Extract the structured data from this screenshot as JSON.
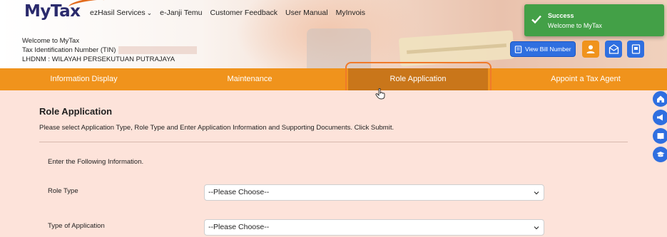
{
  "header": {
    "logo_text": "MyTax",
    "nav": [
      {
        "label": "ezHasil Services",
        "has_dropdown": true
      },
      {
        "label": "e-Janji Temu"
      },
      {
        "label": "Customer Feedback"
      },
      {
        "label": "User Manual"
      },
      {
        "label": "MyInvois"
      }
    ],
    "welcome": {
      "line1": "Welcome to MyTax",
      "line2": "Tax Identification Number (TIN)",
      "line3": "LHDNM : WILAYAH PERSEKUTUAN PUTRAJAYA"
    },
    "view_bill_label": "View Bill Number"
  },
  "toast": {
    "title": "Success",
    "message": "Welcome to MyTax",
    "color": "#43a047"
  },
  "tabs": [
    {
      "label": "Information Display"
    },
    {
      "label": "Maintenance"
    },
    {
      "label": "Role Application",
      "active": true
    },
    {
      "label": "Appoint a Tax Agent"
    }
  ],
  "form": {
    "title": "Role Application",
    "instructions": "Please select Application Type, Role Type and Enter Application Information and Supporting Documents. Click Submit.",
    "section_label": "Enter the Following Information.",
    "fields": [
      {
        "label": "Role Type",
        "value": "--Please Choose--"
      },
      {
        "label": "Type of Application",
        "value": "--Please Choose--"
      }
    ]
  },
  "colors": {
    "accent_orange": "#f0931c",
    "active_tab": "#c9761a",
    "primary_blue": "#2f6fe0",
    "page_bg": "#fde3da"
  },
  "side_icons": [
    "home-icon",
    "megaphone-icon",
    "book-icon",
    "graduation-cap-icon"
  ]
}
